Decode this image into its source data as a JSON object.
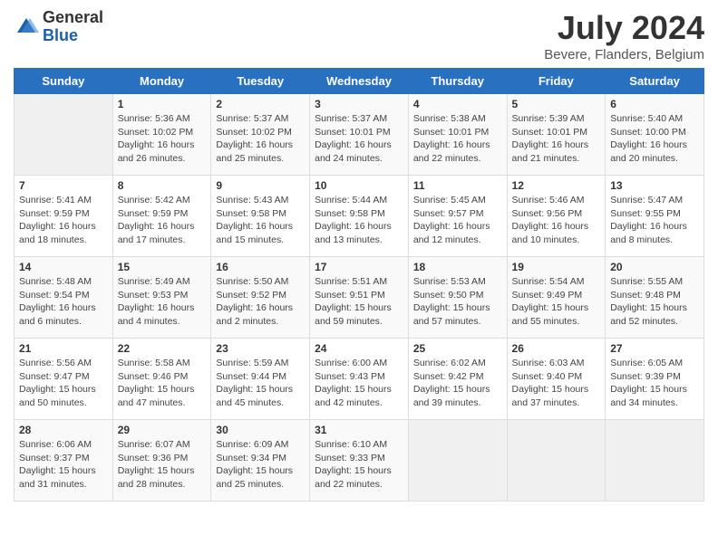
{
  "header": {
    "logo_general": "General",
    "logo_blue": "Blue",
    "month_title": "July 2024",
    "location": "Bevere, Flanders, Belgium"
  },
  "days_of_week": [
    "Sunday",
    "Monday",
    "Tuesday",
    "Wednesday",
    "Thursday",
    "Friday",
    "Saturday"
  ],
  "weeks": [
    [
      {
        "day": "",
        "content": ""
      },
      {
        "day": "1",
        "content": "Sunrise: 5:36 AM\nSunset: 10:02 PM\nDaylight: 16 hours\nand 26 minutes."
      },
      {
        "day": "2",
        "content": "Sunrise: 5:37 AM\nSunset: 10:02 PM\nDaylight: 16 hours\nand 25 minutes."
      },
      {
        "day": "3",
        "content": "Sunrise: 5:37 AM\nSunset: 10:01 PM\nDaylight: 16 hours\nand 24 minutes."
      },
      {
        "day": "4",
        "content": "Sunrise: 5:38 AM\nSunset: 10:01 PM\nDaylight: 16 hours\nand 22 minutes."
      },
      {
        "day": "5",
        "content": "Sunrise: 5:39 AM\nSunset: 10:01 PM\nDaylight: 16 hours\nand 21 minutes."
      },
      {
        "day": "6",
        "content": "Sunrise: 5:40 AM\nSunset: 10:00 PM\nDaylight: 16 hours\nand 20 minutes."
      }
    ],
    [
      {
        "day": "7",
        "content": "Sunrise: 5:41 AM\nSunset: 9:59 PM\nDaylight: 16 hours\nand 18 minutes."
      },
      {
        "day": "8",
        "content": "Sunrise: 5:42 AM\nSunset: 9:59 PM\nDaylight: 16 hours\nand 17 minutes."
      },
      {
        "day": "9",
        "content": "Sunrise: 5:43 AM\nSunset: 9:58 PM\nDaylight: 16 hours\nand 15 minutes."
      },
      {
        "day": "10",
        "content": "Sunrise: 5:44 AM\nSunset: 9:58 PM\nDaylight: 16 hours\nand 13 minutes."
      },
      {
        "day": "11",
        "content": "Sunrise: 5:45 AM\nSunset: 9:57 PM\nDaylight: 16 hours\nand 12 minutes."
      },
      {
        "day": "12",
        "content": "Sunrise: 5:46 AM\nSunset: 9:56 PM\nDaylight: 16 hours\nand 10 minutes."
      },
      {
        "day": "13",
        "content": "Sunrise: 5:47 AM\nSunset: 9:55 PM\nDaylight: 16 hours\nand 8 minutes."
      }
    ],
    [
      {
        "day": "14",
        "content": "Sunrise: 5:48 AM\nSunset: 9:54 PM\nDaylight: 16 hours\nand 6 minutes."
      },
      {
        "day": "15",
        "content": "Sunrise: 5:49 AM\nSunset: 9:53 PM\nDaylight: 16 hours\nand 4 minutes."
      },
      {
        "day": "16",
        "content": "Sunrise: 5:50 AM\nSunset: 9:52 PM\nDaylight: 16 hours\nand 2 minutes."
      },
      {
        "day": "17",
        "content": "Sunrise: 5:51 AM\nSunset: 9:51 PM\nDaylight: 15 hours\nand 59 minutes."
      },
      {
        "day": "18",
        "content": "Sunrise: 5:53 AM\nSunset: 9:50 PM\nDaylight: 15 hours\nand 57 minutes."
      },
      {
        "day": "19",
        "content": "Sunrise: 5:54 AM\nSunset: 9:49 PM\nDaylight: 15 hours\nand 55 minutes."
      },
      {
        "day": "20",
        "content": "Sunrise: 5:55 AM\nSunset: 9:48 PM\nDaylight: 15 hours\nand 52 minutes."
      }
    ],
    [
      {
        "day": "21",
        "content": "Sunrise: 5:56 AM\nSunset: 9:47 PM\nDaylight: 15 hours\nand 50 minutes."
      },
      {
        "day": "22",
        "content": "Sunrise: 5:58 AM\nSunset: 9:46 PM\nDaylight: 15 hours\nand 47 minutes."
      },
      {
        "day": "23",
        "content": "Sunrise: 5:59 AM\nSunset: 9:44 PM\nDaylight: 15 hours\nand 45 minutes."
      },
      {
        "day": "24",
        "content": "Sunrise: 6:00 AM\nSunset: 9:43 PM\nDaylight: 15 hours\nand 42 minutes."
      },
      {
        "day": "25",
        "content": "Sunrise: 6:02 AM\nSunset: 9:42 PM\nDaylight: 15 hours\nand 39 minutes."
      },
      {
        "day": "26",
        "content": "Sunrise: 6:03 AM\nSunset: 9:40 PM\nDaylight: 15 hours\nand 37 minutes."
      },
      {
        "day": "27",
        "content": "Sunrise: 6:05 AM\nSunset: 9:39 PM\nDaylight: 15 hours\nand 34 minutes."
      }
    ],
    [
      {
        "day": "28",
        "content": "Sunrise: 6:06 AM\nSunset: 9:37 PM\nDaylight: 15 hours\nand 31 minutes."
      },
      {
        "day": "29",
        "content": "Sunrise: 6:07 AM\nSunset: 9:36 PM\nDaylight: 15 hours\nand 28 minutes."
      },
      {
        "day": "30",
        "content": "Sunrise: 6:09 AM\nSunset: 9:34 PM\nDaylight: 15 hours\nand 25 minutes."
      },
      {
        "day": "31",
        "content": "Sunrise: 6:10 AM\nSunset: 9:33 PM\nDaylight: 15 hours\nand 22 minutes."
      },
      {
        "day": "",
        "content": ""
      },
      {
        "day": "",
        "content": ""
      },
      {
        "day": "",
        "content": ""
      }
    ]
  ]
}
